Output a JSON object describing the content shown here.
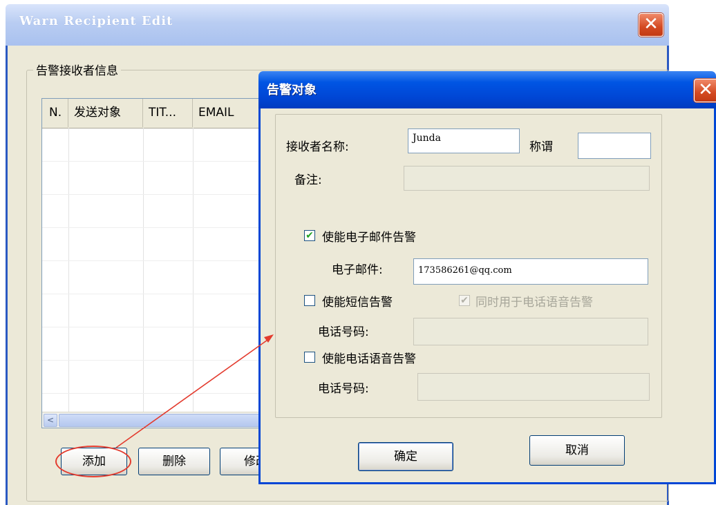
{
  "background_window": {
    "title": "Warn Recipient Edit",
    "close_glyph": "✕",
    "group_label": "告警接收者信息",
    "list_columns": [
      "N.",
      "发送对象",
      "TIT...",
      "EMAIL"
    ],
    "scroll_left_glyph": "<",
    "buttons": {
      "add": "添加",
      "delete": "删除",
      "modify": "修改"
    }
  },
  "dialog": {
    "title": "告警对象",
    "close_glyph": "✕",
    "recipient_name_label": "接收者名称:",
    "recipient_name_value": "Junda",
    "title_label": "称谓",
    "title_value": "",
    "remark_label": "备注:",
    "enable_email_label": "使能电子邮件告警",
    "enable_email_checked": true,
    "email_label": "电子邮件:",
    "email_value": "173586261@qq.com",
    "enable_sms_label": "使能短信告警",
    "enable_sms_checked": false,
    "also_voice_label": "同时用于电话语音告警",
    "also_voice_checked": true,
    "sms_phone_label": "电话号码:",
    "enable_voice_label": "使能电话语音告警",
    "enable_voice_checked": false,
    "voice_phone_label": "电话号码:",
    "ok_label": "确定",
    "cancel_label": "取消"
  },
  "glyphs": {
    "check": "✔"
  },
  "colors": {
    "annotation_red": "#e33b2e",
    "xp_blue": "#0046d5",
    "dialog_bg": "#ece9d8"
  },
  "icons": [
    "close-icon",
    "scroll-left-arrow-icon",
    "checkmark-icon"
  ]
}
